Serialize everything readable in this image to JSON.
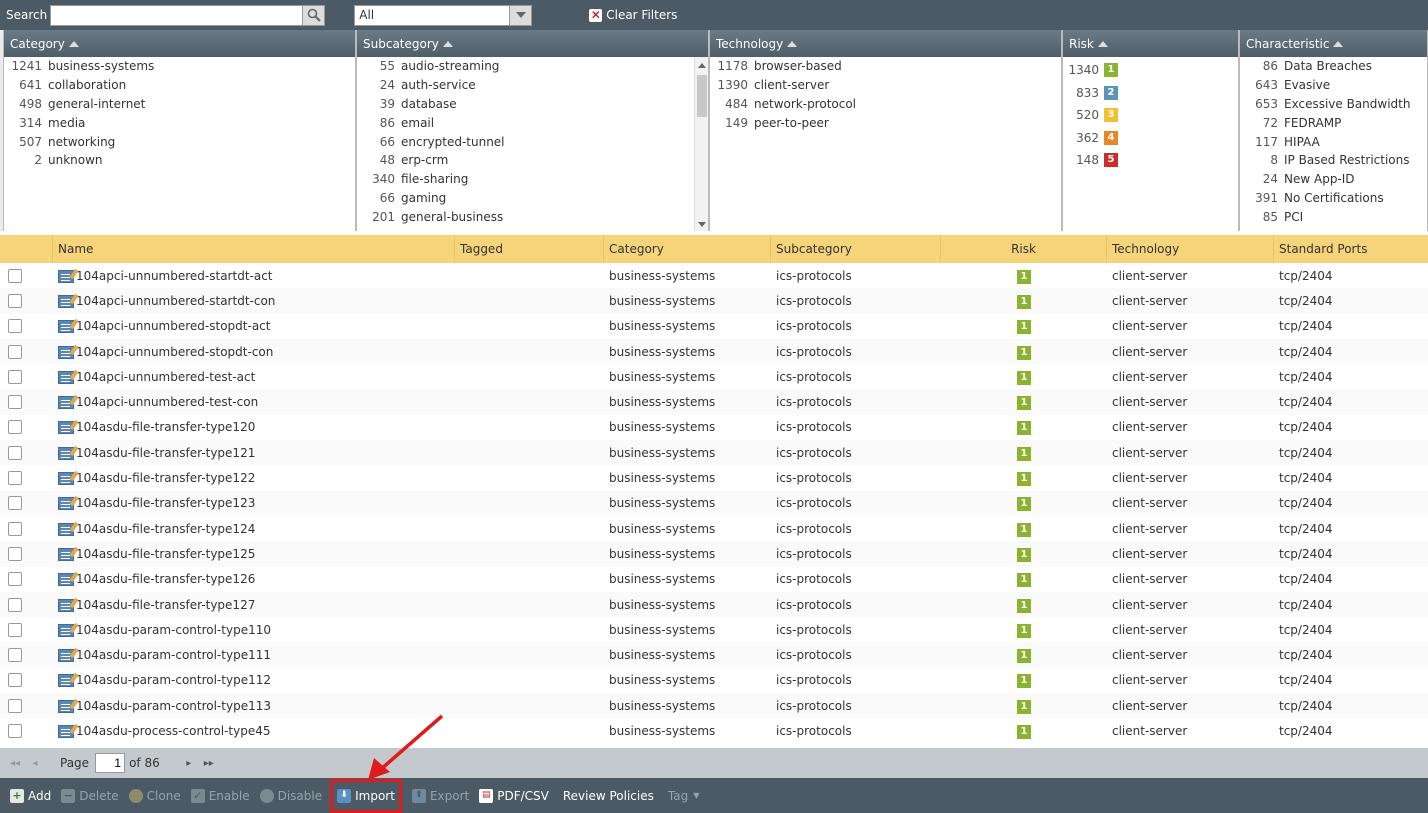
{
  "search": {
    "label": "Search",
    "value": "",
    "filter_value": "All",
    "clear_label": "Clear Filters"
  },
  "filters": {
    "category": {
      "title": "Category",
      "items": [
        {
          "count": "1241",
          "name": "business-systems"
        },
        {
          "count": "641",
          "name": "collaboration"
        },
        {
          "count": "498",
          "name": "general-internet"
        },
        {
          "count": "314",
          "name": "media"
        },
        {
          "count": "507",
          "name": "networking"
        },
        {
          "count": "2",
          "name": "unknown"
        }
      ]
    },
    "subcategory": {
      "title": "Subcategory",
      "items": [
        {
          "count": "55",
          "name": "audio-streaming"
        },
        {
          "count": "24",
          "name": "auth-service"
        },
        {
          "count": "39",
          "name": "database"
        },
        {
          "count": "86",
          "name": "email"
        },
        {
          "count": "66",
          "name": "encrypted-tunnel"
        },
        {
          "count": "48",
          "name": "erp-crm"
        },
        {
          "count": "340",
          "name": "file-sharing"
        },
        {
          "count": "66",
          "name": "gaming"
        },
        {
          "count": "201",
          "name": "general-business"
        }
      ]
    },
    "technology": {
      "title": "Technology",
      "items": [
        {
          "count": "1178",
          "name": "browser-based"
        },
        {
          "count": "1390",
          "name": "client-server"
        },
        {
          "count": "484",
          "name": "network-protocol"
        },
        {
          "count": "149",
          "name": "peer-to-peer"
        }
      ]
    },
    "risk": {
      "title": "Risk",
      "items": [
        {
          "count": "1340",
          "level": "1",
          "color": "#8cb32f"
        },
        {
          "count": "833",
          "level": "2",
          "color": "#5b95b5"
        },
        {
          "count": "520",
          "level": "3",
          "color": "#f0c232"
        },
        {
          "count": "362",
          "level": "4",
          "color": "#e8862a"
        },
        {
          "count": "148",
          "level": "5",
          "color": "#c9302c"
        }
      ]
    },
    "characteristic": {
      "title": "Characteristic",
      "items": [
        {
          "count": "86",
          "name": "Data Breaches"
        },
        {
          "count": "643",
          "name": "Evasive"
        },
        {
          "count": "653",
          "name": "Excessive Bandwidth"
        },
        {
          "count": "72",
          "name": "FEDRAMP"
        },
        {
          "count": "117",
          "name": "HIPAA"
        },
        {
          "count": "8",
          "name": "IP Based Restrictions"
        },
        {
          "count": "24",
          "name": "New App-ID"
        },
        {
          "count": "391",
          "name": "No Certifications"
        },
        {
          "count": "85",
          "name": "PCI"
        }
      ]
    }
  },
  "table": {
    "columns": [
      "Name",
      "Tagged",
      "Category",
      "Subcategory",
      "Risk",
      "Technology",
      "Standard Ports"
    ],
    "rows": [
      {
        "name": "104apci-unnumbered-startdt-act",
        "tagged": "",
        "category": "business-systems",
        "subcategory": "ics-protocols",
        "risk": "1",
        "technology": "client-server",
        "ports": "tcp/2404"
      },
      {
        "name": "104apci-unnumbered-startdt-con",
        "tagged": "",
        "category": "business-systems",
        "subcategory": "ics-protocols",
        "risk": "1",
        "technology": "client-server",
        "ports": "tcp/2404"
      },
      {
        "name": "104apci-unnumbered-stopdt-act",
        "tagged": "",
        "category": "business-systems",
        "subcategory": "ics-protocols",
        "risk": "1",
        "technology": "client-server",
        "ports": "tcp/2404"
      },
      {
        "name": "104apci-unnumbered-stopdt-con",
        "tagged": "",
        "category": "business-systems",
        "subcategory": "ics-protocols",
        "risk": "1",
        "technology": "client-server",
        "ports": "tcp/2404"
      },
      {
        "name": "104apci-unnumbered-test-act",
        "tagged": "",
        "category": "business-systems",
        "subcategory": "ics-protocols",
        "risk": "1",
        "technology": "client-server",
        "ports": "tcp/2404"
      },
      {
        "name": "104apci-unnumbered-test-con",
        "tagged": "",
        "category": "business-systems",
        "subcategory": "ics-protocols",
        "risk": "1",
        "technology": "client-server",
        "ports": "tcp/2404"
      },
      {
        "name": "104asdu-file-transfer-type120",
        "tagged": "",
        "category": "business-systems",
        "subcategory": "ics-protocols",
        "risk": "1",
        "technology": "client-server",
        "ports": "tcp/2404"
      },
      {
        "name": "104asdu-file-transfer-type121",
        "tagged": "",
        "category": "business-systems",
        "subcategory": "ics-protocols",
        "risk": "1",
        "technology": "client-server",
        "ports": "tcp/2404"
      },
      {
        "name": "104asdu-file-transfer-type122",
        "tagged": "",
        "category": "business-systems",
        "subcategory": "ics-protocols",
        "risk": "1",
        "technology": "client-server",
        "ports": "tcp/2404"
      },
      {
        "name": "104asdu-file-transfer-type123",
        "tagged": "",
        "category": "business-systems",
        "subcategory": "ics-protocols",
        "risk": "1",
        "technology": "client-server",
        "ports": "tcp/2404"
      },
      {
        "name": "104asdu-file-transfer-type124",
        "tagged": "",
        "category": "business-systems",
        "subcategory": "ics-protocols",
        "risk": "1",
        "technology": "client-server",
        "ports": "tcp/2404"
      },
      {
        "name": "104asdu-file-transfer-type125",
        "tagged": "",
        "category": "business-systems",
        "subcategory": "ics-protocols",
        "risk": "1",
        "technology": "client-server",
        "ports": "tcp/2404"
      },
      {
        "name": "104asdu-file-transfer-type126",
        "tagged": "",
        "category": "business-systems",
        "subcategory": "ics-protocols",
        "risk": "1",
        "technology": "client-server",
        "ports": "tcp/2404"
      },
      {
        "name": "104asdu-file-transfer-type127",
        "tagged": "",
        "category": "business-systems",
        "subcategory": "ics-protocols",
        "risk": "1",
        "technology": "client-server",
        "ports": "tcp/2404"
      },
      {
        "name": "104asdu-param-control-type110",
        "tagged": "",
        "category": "business-systems",
        "subcategory": "ics-protocols",
        "risk": "1",
        "technology": "client-server",
        "ports": "tcp/2404"
      },
      {
        "name": "104asdu-param-control-type111",
        "tagged": "",
        "category": "business-systems",
        "subcategory": "ics-protocols",
        "risk": "1",
        "technology": "client-server",
        "ports": "tcp/2404"
      },
      {
        "name": "104asdu-param-control-type112",
        "tagged": "",
        "category": "business-systems",
        "subcategory": "ics-protocols",
        "risk": "1",
        "technology": "client-server",
        "ports": "tcp/2404"
      },
      {
        "name": "104asdu-param-control-type113",
        "tagged": "",
        "category": "business-systems",
        "subcategory": "ics-protocols",
        "risk": "1",
        "technology": "client-server",
        "ports": "tcp/2404"
      },
      {
        "name": "104asdu-process-control-type45",
        "tagged": "",
        "category": "business-systems",
        "subcategory": "ics-protocols",
        "risk": "1",
        "technology": "client-server",
        "ports": "tcp/2404"
      }
    ]
  },
  "pager": {
    "page_label": "Page",
    "page": "1",
    "of_label": "of 86"
  },
  "toolbar": {
    "add": "Add",
    "delete": "Delete",
    "clone": "Clone",
    "enable": "Enable",
    "disable": "Disable",
    "import": "Import",
    "export": "Export",
    "pdfcsv": "PDF/CSV",
    "review": "Review Policies",
    "tag": "Tag"
  },
  "colors": {
    "header_bg": "#4b5a64",
    "table_header": "#f5d47a",
    "risk1": "#8cb32f",
    "highlight": "#e01b1b"
  },
  "icons": [
    "search-icon",
    "clear-filters-icon",
    "app-icon",
    "add-icon",
    "import-icon",
    "pdf-icon"
  ]
}
